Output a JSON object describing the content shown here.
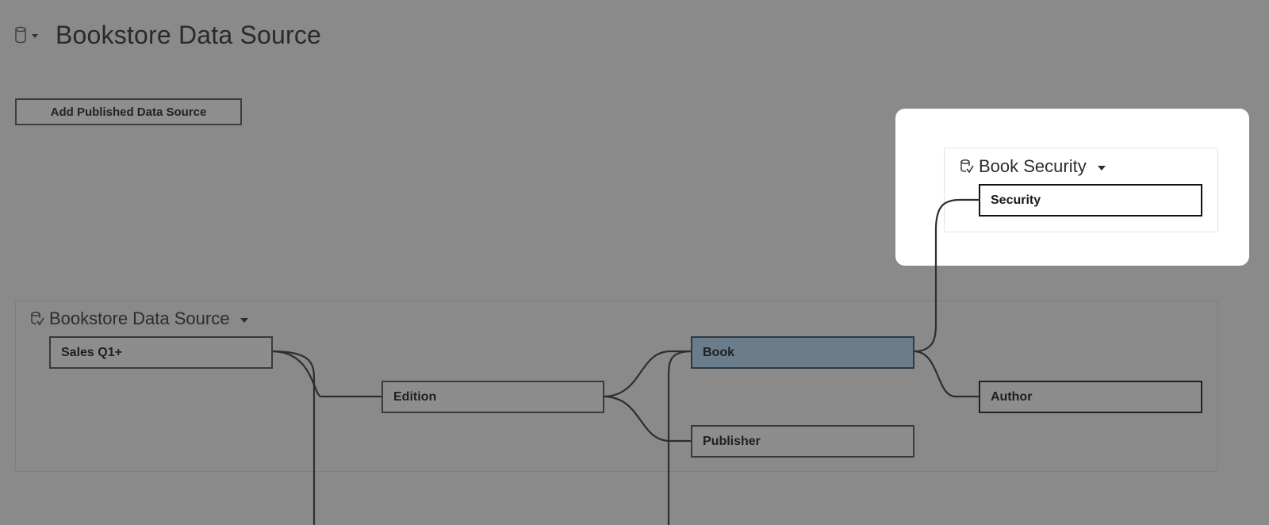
{
  "header": {
    "title": "Bookstore Data Source",
    "icon": "database-icon"
  },
  "toolbar": {
    "add_published_label": "Add Published Data Source"
  },
  "security_panel": {
    "title": "Book Security",
    "icon": "published-datasource-icon",
    "tables": [
      {
        "label": "Security"
      }
    ]
  },
  "main_panel": {
    "title": "Bookstore Data Source",
    "icon": "published-datasource-icon",
    "tables": {
      "sales": "Sales Q1+",
      "edition": "Edition",
      "book": "Book",
      "publisher": "Publisher",
      "author": "Author"
    }
  },
  "colors": {
    "background": "#8a8a8a",
    "highlight": "#ffffff",
    "selected_table": "#6b7c8a"
  }
}
